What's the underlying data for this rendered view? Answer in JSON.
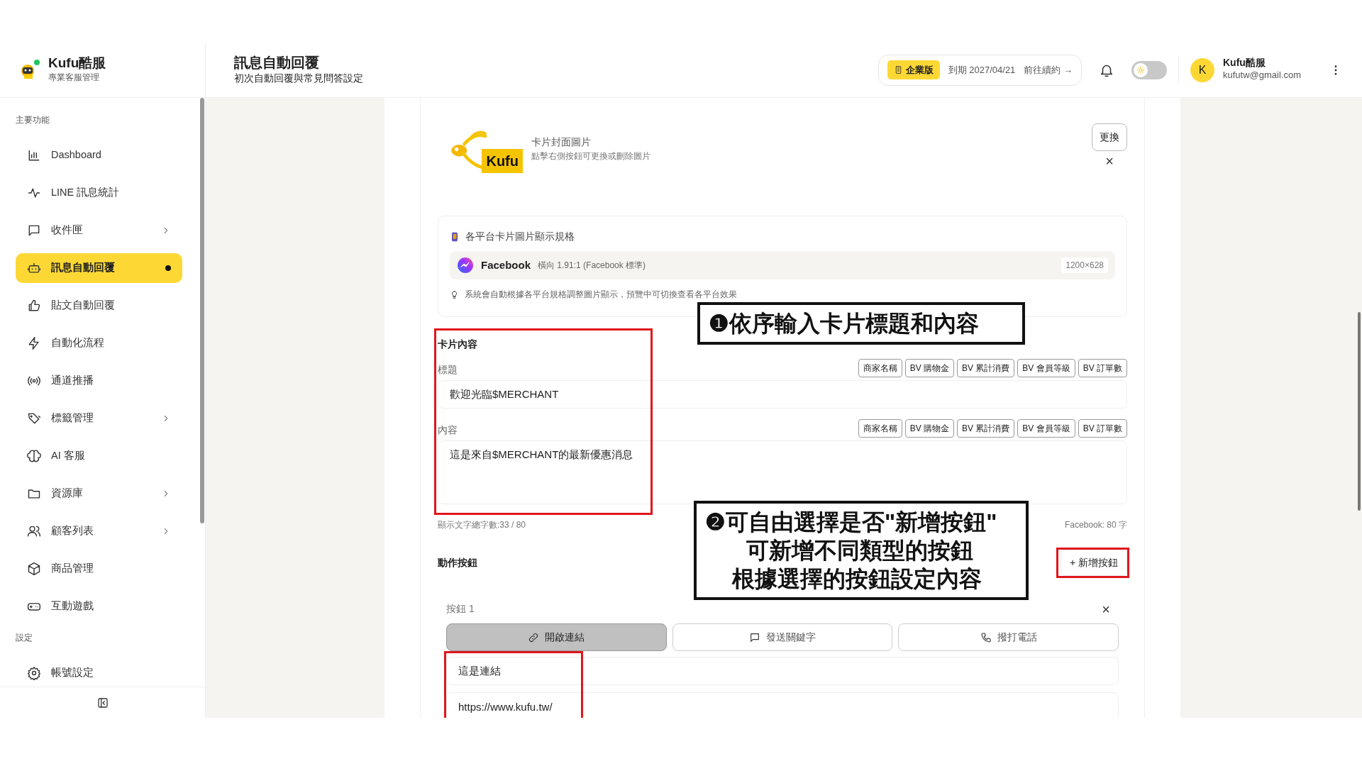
{
  "brand": {
    "name": "Kufu酷服",
    "subtitle": "專業客服管理"
  },
  "page": {
    "title": "訊息自動回覆",
    "subtitle": "初次自動回覆與常見問答設定"
  },
  "plan": {
    "badge": "企業版",
    "expiry": "到期 2027/04/21",
    "renew": "前往續約 →"
  },
  "theme_toggle": {
    "on": false
  },
  "user": {
    "initial": "K",
    "name": "Kufu酷服",
    "email": "kufutw@gmail.com"
  },
  "sidebar": {
    "sections": [
      {
        "title": "主要功能",
        "items": [
          {
            "label": "Dashboard",
            "selected": false,
            "expandable": false
          },
          {
            "label": "LINE 訊息統計",
            "selected": false,
            "expandable": false
          },
          {
            "label": "收件匣",
            "selected": false,
            "expandable": true
          },
          {
            "label": "訊息自動回覆",
            "selected": true,
            "expandable": false
          },
          {
            "label": "貼文自動回覆",
            "selected": false,
            "expandable": false
          },
          {
            "label": "自動化流程",
            "selected": false,
            "expandable": false
          },
          {
            "label": "通道推播",
            "selected": false,
            "expandable": false
          },
          {
            "label": "標籤管理",
            "selected": false,
            "expandable": true
          },
          {
            "label": "AI 客服",
            "selected": false,
            "expandable": false
          },
          {
            "label": "資源庫",
            "selected": false,
            "expandable": true
          },
          {
            "label": "顧客列表",
            "selected": false,
            "expandable": true
          },
          {
            "label": "商品管理",
            "selected": false,
            "expandable": false
          },
          {
            "label": "互動遊戲",
            "selected": false,
            "expandable": false
          }
        ]
      },
      {
        "title": "設定",
        "items": [
          {
            "label": "帳號設定",
            "selected": false,
            "expandable": false
          }
        ]
      }
    ]
  },
  "cover": {
    "logo_text": "Kufu",
    "title": "卡片封面圖片",
    "hint": "點擊右側按鈕可更換或刪除圖片",
    "change_button": "更換",
    "close": "×"
  },
  "spec": {
    "title": "各平台卡片圖片顯示規格",
    "platform": "Facebook",
    "ratio": "橫向 1.91:1 (Facebook 標準)",
    "size": "1200×628",
    "hint": "系統會自動根據各平台規格調整圖片顯示，預覽中可切換查看各平台效果"
  },
  "content": {
    "heading": "卡片內容",
    "fields": [
      {
        "label": "標題",
        "value": "歡迎光臨$MERCHANT",
        "kind": "input",
        "tokens": [
          "商家名稱",
          "BV 購物金",
          "BV 累計消費",
          "BV 會員等級",
          "BV 訂單數"
        ]
      },
      {
        "label": "內容",
        "value": "這是來自$MERCHANT的最新優惠消息",
        "kind": "textarea",
        "tokens": [
          "商家名稱",
          "BV 購物金",
          "BV 累計消費",
          "BV 會員等級",
          "BV 訂單數"
        ]
      }
    ],
    "counter": "顯示文字總字數:33 / 80",
    "limit": "Facebook: 80 字"
  },
  "actions": {
    "heading": "動作按鈕",
    "add_button": "+ 新增按鈕",
    "buttons": [
      {
        "label": "按鈕 1",
        "close": "×",
        "types": [
          {
            "label": "開啟連結",
            "selected": true
          },
          {
            "label": "發送關鍵字",
            "selected": false
          },
          {
            "label": "撥打電話",
            "selected": false
          }
        ],
        "text_value": "這是連結",
        "url_value": "https://www.kufu.tw/"
      }
    ]
  },
  "annotations": [
    {
      "lines": [
        "❶依序輸入卡片標題和內容"
      ]
    },
    {
      "lines": [
        "❷可自由選擇是否\"新增按鈕\"",
        "可新增不同類型的按鈕",
        "根據選擇的按鈕設定內容"
      ]
    }
  ]
}
